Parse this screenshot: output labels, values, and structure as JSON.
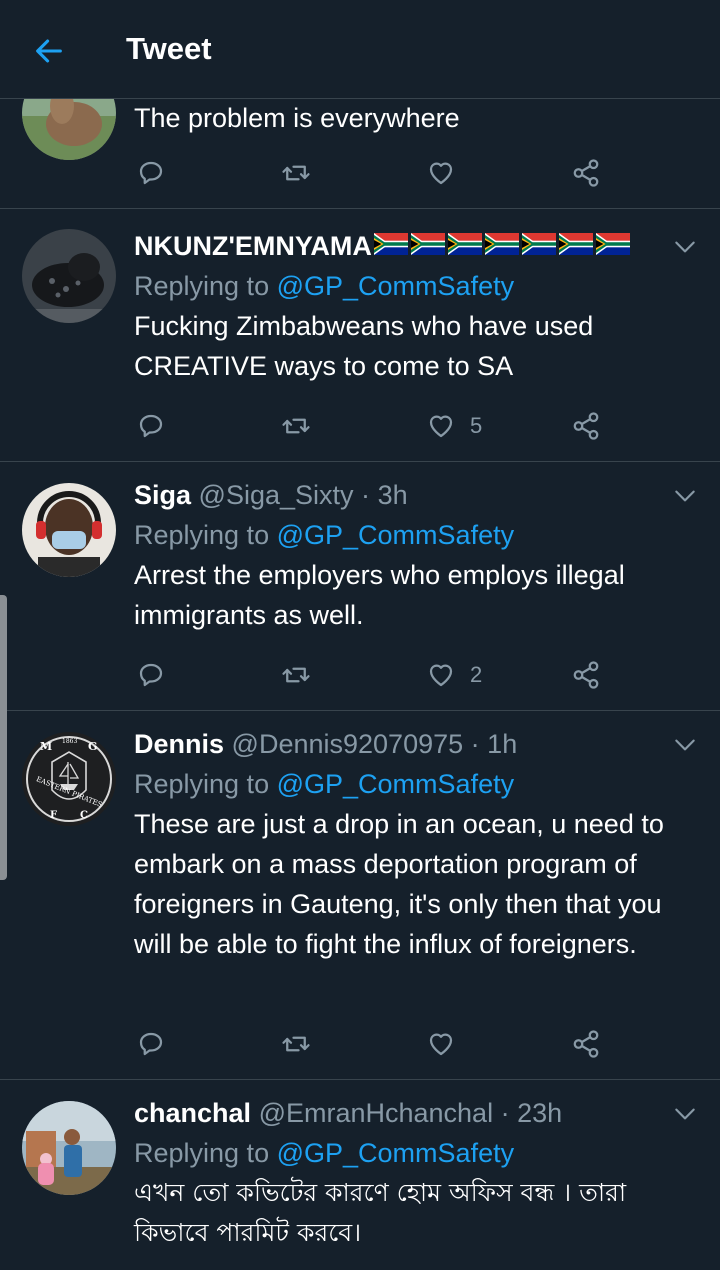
{
  "header": {
    "title": "Tweet"
  },
  "tweets": [
    {
      "text": "The problem is everywhere",
      "likes": null
    },
    {
      "name": "NKUNZ'EMNYAMA",
      "flag_count": 7,
      "replying_label": "Replying to",
      "mention": "@GP_CommSafety",
      "text": "Fucking Zimbabweans who have used CREATIVE ways to come to SA",
      "likes": "5"
    },
    {
      "name": "Siga",
      "handle": "@Siga_Sixty",
      "separator": "·",
      "time": "3h",
      "replying_label": "Replying to",
      "mention": "@GP_CommSafety",
      "text": "Arrest the employers who employs illegal immigrants as well.",
      "likes": "2"
    },
    {
      "name": "Dennis",
      "handle": "@Dennis92070975",
      "separator": "·",
      "time": "1h",
      "replying_label": "Replying to",
      "mention": "@GP_CommSafety",
      "text": "These are just a drop in an ocean, u need to embark on a mass deportation program of foreigners in Gauteng, it's only then that you will be able to fight the influx of foreigners.",
      "avatar_text": {
        "top_left": "M",
        "top_right": "G",
        "year": "1863",
        "band": "EASTERN PIRATES",
        "bottom_left": "F",
        "bottom_right": "C"
      },
      "likes": null
    },
    {
      "name": "chanchal",
      "handle": "@EmranHchanchal",
      "separator": "·",
      "time": "23h",
      "replying_label": "Replying to",
      "mention": "@GP_CommSafety",
      "text": "এখন তো কভিটের কারণে হোম অফিস বন্ধ । তারা কিভাবে পারমিট করবে।"
    }
  ],
  "colors": {
    "background": "#15202b",
    "divider": "#38444d",
    "accent": "#1da1f2",
    "muted": "#8899a6",
    "text": "#ffffff"
  },
  "icons": {
    "back": "arrow-left-icon",
    "reply": "comment-icon",
    "retweet": "retweet-icon",
    "like": "heart-icon",
    "share": "share-icon",
    "more": "chevron-down-icon"
  }
}
